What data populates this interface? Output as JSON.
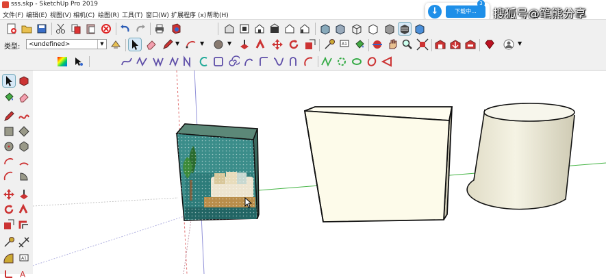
{
  "window": {
    "title": "sss.skp - SketchUp Pro 2019"
  },
  "menu": [
    {
      "label": "文件(F)"
    },
    {
      "label": "编辑(E)"
    },
    {
      "label": "视图(V)"
    },
    {
      "label": "相机(C)"
    },
    {
      "label": "绘图(R)"
    },
    {
      "label": "工具(T)"
    },
    {
      "label": "窗口(W)"
    },
    {
      "label": "扩展程序 (x)"
    },
    {
      "label": "帮助(H)"
    }
  ],
  "layer": {
    "label": "类型:",
    "value": "<undefined>"
  },
  "download": {
    "arrow": "↓",
    "label": "下载中...",
    "badge": "3"
  },
  "watermark": "搜狐号@笔熊分享",
  "colors": {
    "accent": "#1e8fe8",
    "toolbar_bg": "#f0f0f0",
    "box_face": "#fffdf0",
    "cylinder_body": "#f4f2e2"
  }
}
